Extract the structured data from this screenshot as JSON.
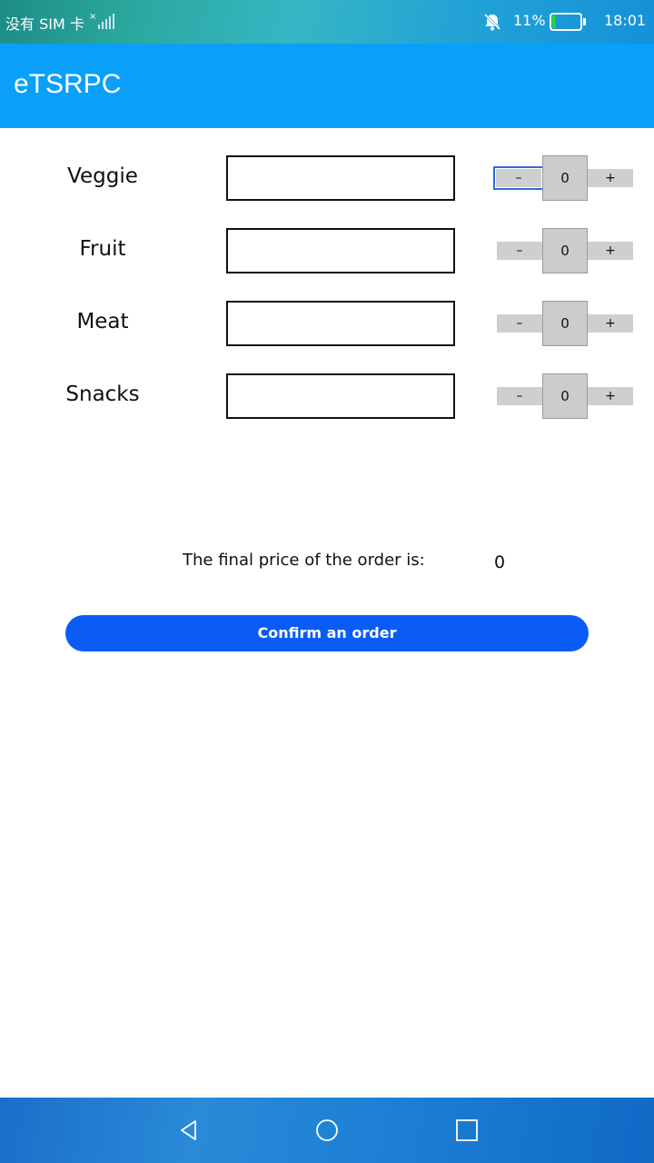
{
  "status_bar": {
    "carrier": "没有 SIM 卡",
    "battery_percent": "11%",
    "battery_level": 0.11,
    "time": "18:01",
    "icons": [
      "no-sim-signal-icon",
      "bell-muted-icon",
      "battery-icon"
    ]
  },
  "header": {
    "title": "eTSRPC"
  },
  "items": [
    {
      "label": "Veggie",
      "input_value": "",
      "minus": "–",
      "count": "0",
      "plus": "+"
    },
    {
      "label": "Fruit",
      "input_value": "",
      "minus": "–",
      "count": "0",
      "plus": "+"
    },
    {
      "label": "Meat",
      "input_value": "",
      "minus": "–",
      "count": "0",
      "plus": "+"
    },
    {
      "label": "Snacks",
      "input_value": "",
      "minus": "–",
      "count": "0",
      "plus": "+"
    }
  ],
  "summary": {
    "price_label": "The final price of the order is:",
    "price_value": "0"
  },
  "confirm_button": {
    "label": "Confirm an order"
  },
  "nav_bar": {
    "icons": [
      "back-icon",
      "home-icon",
      "recent-apps-icon"
    ]
  },
  "colors": {
    "header_bg": "#0aa0f9",
    "button_bg": "#0b5cf5",
    "stepper_bg": "#cccccc",
    "focus_outline": "#2f6bd9"
  }
}
